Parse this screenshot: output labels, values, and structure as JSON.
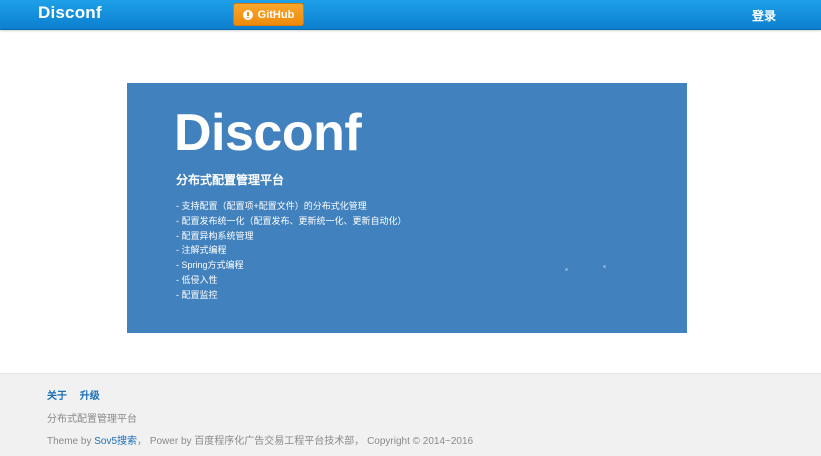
{
  "navbar": {
    "brand": "Disconf",
    "github_label": "GitHub",
    "github_icon": "info-circle-icon",
    "login_label": "登录"
  },
  "banner": {
    "title": "Disconf",
    "subtitle": "分布式配置管理平台",
    "features": [
      "- 支持配置（配置项+配置文件）的分布式化管理",
      "- 配置发布统一化（配置发布、更新统一化、更新自动化）",
      "- 配置异构系统管理",
      "- 注解式编程",
      "- Spring方式编程",
      "- 低侵入性",
      "- 配置监控"
    ],
    "background_color": "#4081be"
  },
  "footer": {
    "links": [
      "关于",
      "升级"
    ],
    "description": "分布式配置管理平台",
    "theme_prefix": "Theme by",
    "theme_link": "Sov5搜索",
    "power_text": "，  Power by 百度程序化广告交易工程平台技术部，  Copyright © 2014~2016"
  },
  "colors": {
    "navbar": "#1590dc",
    "github_button": "#f59a1a",
    "link": "#1a6fb8",
    "footer_bg": "#f1f1f1"
  }
}
